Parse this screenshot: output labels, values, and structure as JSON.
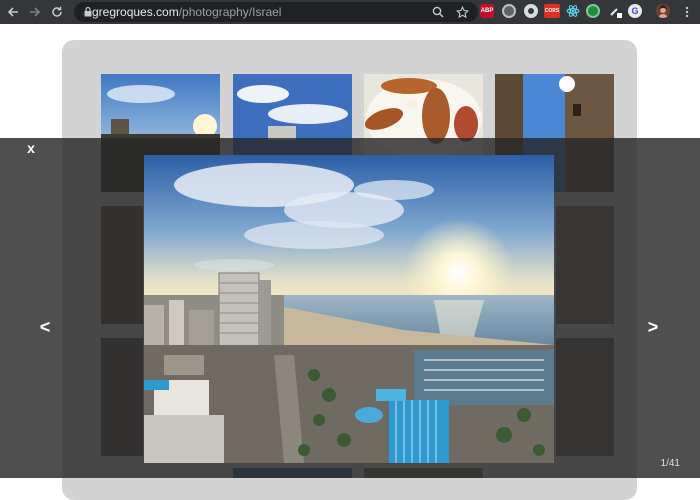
{
  "browser": {
    "url_host": "gregroques.com",
    "url_path": "/photography/Israel",
    "extensions": [
      {
        "icon": "adblock-icon",
        "label": "ABP",
        "color": "#c70d2c"
      },
      {
        "icon": "circle-ext-icon",
        "label": "",
        "color": "#9aa0a6"
      },
      {
        "icon": "sync-ext-icon",
        "label": "",
        "color": "#5f9ea0"
      },
      {
        "icon": "cors-ext-icon",
        "label": "CORS",
        "color": "#d93025"
      },
      {
        "icon": "react-ext-icon",
        "label": "",
        "color": "#61dafb"
      },
      {
        "icon": "green-ext-icon",
        "label": "",
        "color": "#34a853"
      },
      {
        "icon": "dropper-ext-icon",
        "label": "",
        "color": "#e8eaed"
      },
      {
        "icon": "grammarly-ext-icon",
        "label": "G",
        "color": "#3f51b5"
      }
    ]
  },
  "lightbox": {
    "close_label": "x",
    "prev_label": "<",
    "next_label": ">",
    "counter": "1/41"
  }
}
